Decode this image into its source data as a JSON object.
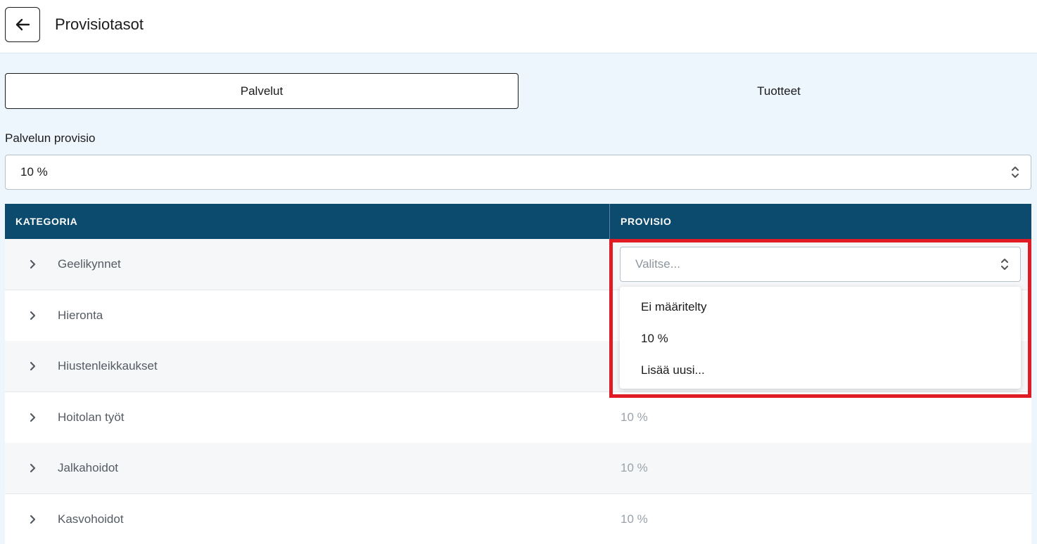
{
  "header": {
    "title": "Provisiotasot"
  },
  "tabs": [
    {
      "label": "Palvelut",
      "active": true
    },
    {
      "label": "Tuotteet",
      "active": false
    }
  ],
  "service_commission": {
    "label": "Palvelun provisio",
    "value": "10 %"
  },
  "table": {
    "columns": [
      "KATEGORIA",
      "PROVISIO"
    ],
    "rows": [
      {
        "category": "Geelikynnet",
        "commission": ""
      },
      {
        "category": "Hieronta",
        "commission": ""
      },
      {
        "category": "Hiustenleikkaukset",
        "commission": ""
      },
      {
        "category": "Hoitolan työt",
        "commission": "10 %"
      },
      {
        "category": "Jalkahoidot",
        "commission": "10 %"
      },
      {
        "category": "Kasvohoidot",
        "commission": "10 %"
      }
    ]
  },
  "open_select": {
    "placeholder": "Valitse...",
    "options": [
      "Ei määritelty",
      "10 %",
      "Lisää uusi..."
    ]
  },
  "colors": {
    "table_header": "#0c4a6e",
    "highlight": "#e01b24",
    "page_background": "#eef6fd"
  }
}
